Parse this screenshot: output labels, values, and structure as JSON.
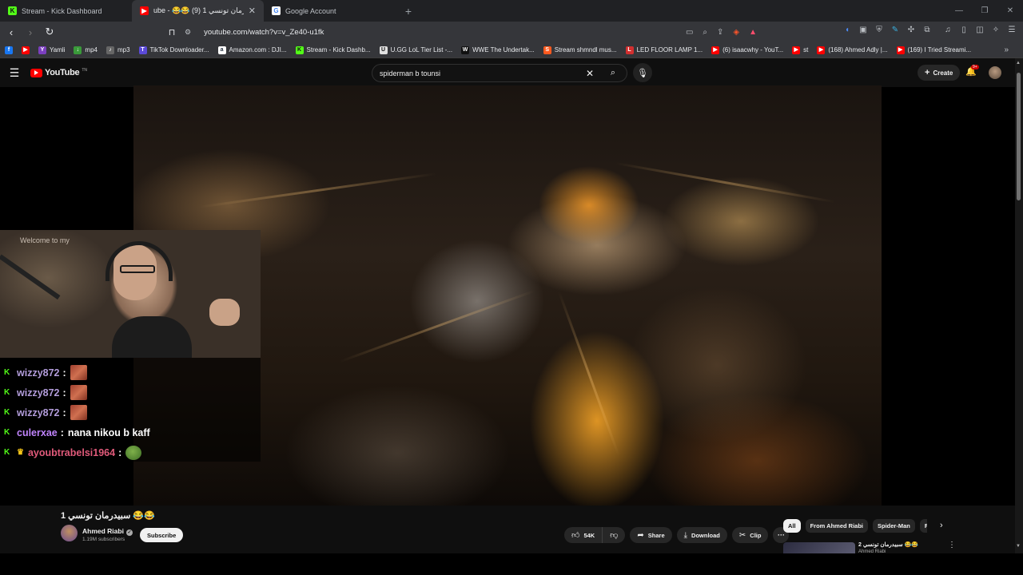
{
  "browser": {
    "tabs": [
      {
        "label": "Stream - Kick Dashboard",
        "icon": "kick-icon",
        "color": "#53fc18",
        "active": false
      },
      {
        "label": "ube - 😂😂 سبيدرمان تونسي 1 (9)",
        "icon": "youtube-icon",
        "color": "#ff0000",
        "active": true
      },
      {
        "label": "Google Account",
        "icon": "google-icon",
        "color": "#4285f4",
        "active": false
      }
    ],
    "new_tab": "+",
    "url": "youtube.com/watch?v=v_Ze40-u1fk",
    "bookmarks": [
      {
        "label": "",
        "icon": "facebook-icon",
        "color": "#1877f2",
        "glyph": "f"
      },
      {
        "label": "",
        "icon": "youtube-icon",
        "color": "#ff0000",
        "glyph": "▶"
      },
      {
        "label": "Yamli",
        "icon": "yamli-icon",
        "color": "#7b3fbf",
        "glyph": "Y"
      },
      {
        "label": "mp4",
        "icon": "download-icon",
        "color": "#3a9a3a",
        "glyph": "↓"
      },
      {
        "label": "mp3",
        "icon": "mp3-icon",
        "color": "#666666",
        "glyph": "♪"
      },
      {
        "label": "TikTok Downloader...",
        "icon": "tiktok-icon",
        "color": "#5b4ad8",
        "glyph": "T"
      },
      {
        "label": "Amazon.com : DJI...",
        "icon": "amazon-icon",
        "color": "#232f3e",
        "glyph": "a"
      },
      {
        "label": "Stream - Kick Dashb...",
        "icon": "kick-icon",
        "color": "#53fc18",
        "glyph": "K"
      },
      {
        "label": "U.GG LoL Tier List -...",
        "icon": "ugg-icon",
        "color": "#e0e0e0",
        "glyph": "U"
      },
      {
        "label": "WWE The Undertak...",
        "icon": "wwe-icon",
        "color": "#111111",
        "glyph": "W"
      },
      {
        "label": "Stream shmndl mus...",
        "icon": "stream-icon",
        "color": "#ff5a1f",
        "glyph": "S"
      },
      {
        "label": "LED FLOOR LAMP 1...",
        "icon": "lamp-icon",
        "color": "#d32f2f",
        "glyph": "L"
      },
      {
        "label": "(6) isaacwhy - YouT...",
        "icon": "youtube-icon",
        "color": "#ff0000",
        "glyph": "▶"
      },
      {
        "label": "st",
        "icon": "youtube-icon",
        "color": "#ff0000",
        "glyph": "▶"
      },
      {
        "label": "(168) Ahmed Adly |...",
        "icon": "youtube-icon",
        "color": "#ff0000",
        "glyph": "▶"
      },
      {
        "label": "(169) I Tried Streami...",
        "icon": "youtube-icon",
        "color": "#ff0000",
        "glyph": "▶"
      }
    ],
    "bookmarks_more": "»"
  },
  "youtube": {
    "logo": "YouTube",
    "logo_tm": "TN",
    "search_query": "spiderman b tounsi",
    "create_label": "Create",
    "notif_badge": "9+"
  },
  "chat": {
    "messages": [
      {
        "user": "wizzy872",
        "color": "#b39ddb",
        "message": "",
        "emote": "emote"
      },
      {
        "user": "wizzy872",
        "color": "#b39ddb",
        "message": "",
        "emote": "emote"
      },
      {
        "user": "wizzy872",
        "color": "#b39ddb",
        "message": "",
        "emote": "emote"
      },
      {
        "user": "culerxae",
        "color": "#c084fc",
        "message": "nana nikou b kaff",
        "emote": ""
      },
      {
        "user": "ayoubtrabelsi1964",
        "color": "#e05a7a",
        "message": "",
        "emote": "frog",
        "crown": true
      }
    ],
    "webcam_sign": "Welcome to my"
  },
  "video": {
    "title": "😂😂 سبيدرمان تونسي 1",
    "channel": "Ahmed Riabi",
    "subscribers": "1.19M subscribers",
    "subscribe_label": "Subscribe",
    "likes": "54K",
    "share_label": "Share",
    "download_label": "Download",
    "clip_label": "Clip",
    "more_label": "···"
  },
  "related": {
    "chips": [
      "All",
      "From Ahmed Riabi",
      "Spider-Man",
      "Related"
    ],
    "first_title": "😂😂 سبيدرمان تونسي 2",
    "first_channel": "Ahmed Riabi"
  }
}
